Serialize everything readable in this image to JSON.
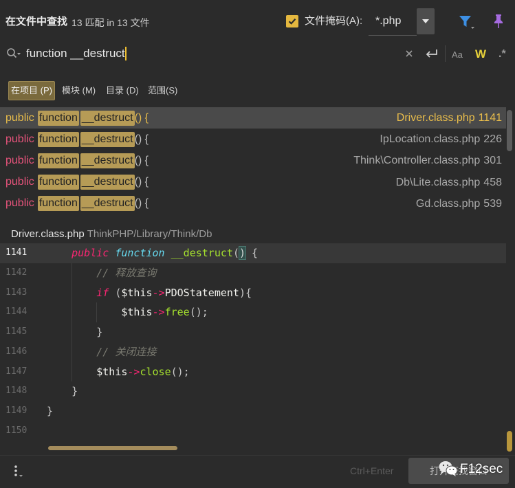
{
  "header": {
    "title": "在文件中查找",
    "summary": "13 匹配 in 13 文件"
  },
  "file_mask": {
    "enabled": true,
    "label": "文件掩码(A):",
    "value": "*.php"
  },
  "search": {
    "query": "function __destruct"
  },
  "search_options": {
    "match_case": "Aa",
    "whole_words": "W",
    "regex": ".*"
  },
  "scope_tabs": [
    {
      "label": "在项目 (P)",
      "selected": true
    },
    {
      "label": "模块 (M)",
      "selected": false
    },
    {
      "label": "目录 (D)",
      "selected": false
    },
    {
      "label": "范围(S)",
      "selected": false
    }
  ],
  "results": [
    {
      "before": "public",
      "match": [
        "function",
        "__destruct"
      ],
      "after": "() {",
      "file": "Driver.class.php",
      "line": "1141",
      "selected": true
    },
    {
      "before": "public",
      "match": [
        "function",
        "__destruct"
      ],
      "after": "() {",
      "file": "IpLocation.class.php",
      "line": "226",
      "selected": false
    },
    {
      "before": "public",
      "match": [
        "function",
        "__destruct"
      ],
      "after": "() {",
      "file": "Think\\Controller.class.php",
      "line": "301",
      "selected": false
    },
    {
      "before": "public",
      "match": [
        "function",
        "__destruct"
      ],
      "after": "() {",
      "file": "Db\\Lite.class.php",
      "line": "458",
      "selected": false
    },
    {
      "before": "public",
      "match": [
        "function",
        "__destruct"
      ],
      "after": "() {",
      "file": "Gd.class.php",
      "line": "539",
      "selected": false
    }
  ],
  "preview": {
    "file": "Driver.class.php",
    "path": "ThinkPHP/Library/Think/Db",
    "lines": [
      {
        "num": "1141",
        "current": true,
        "tokens": [
          [
            "    ",
            "w"
          ],
          [
            "public",
            "k"
          ],
          [
            " ",
            "w"
          ],
          [
            "function",
            "s"
          ],
          [
            " ",
            "w"
          ],
          [
            "__destruct",
            "f"
          ],
          [
            "(",
            "p"
          ],
          [
            ")",
            "m"
          ],
          [
            " {",
            "p"
          ]
        ]
      },
      {
        "num": "1142",
        "tokens": [
          [
            "        ",
            "w"
          ],
          [
            "// 释放查询",
            "c"
          ]
        ]
      },
      {
        "num": "1143",
        "tokens": [
          [
            "        ",
            "w"
          ],
          [
            "if",
            "k"
          ],
          [
            " (",
            "p"
          ],
          [
            "$this",
            "v"
          ],
          [
            "->",
            "o"
          ],
          [
            "PDOStatement",
            "v"
          ],
          [
            "){",
            "p"
          ]
        ]
      },
      {
        "num": "1144",
        "tokens": [
          [
            "            ",
            "w"
          ],
          [
            "$this",
            "v"
          ],
          [
            "->",
            "o"
          ],
          [
            "free",
            "f"
          ],
          [
            "();",
            "p"
          ]
        ]
      },
      {
        "num": "1145",
        "tokens": [
          [
            "        ",
            "w"
          ],
          [
            "}",
            "p"
          ]
        ]
      },
      {
        "num": "1146",
        "tokens": [
          [
            "        ",
            "w"
          ],
          [
            "// 关闭连接",
            "c"
          ]
        ]
      },
      {
        "num": "1147",
        "tokens": [
          [
            "        ",
            "w"
          ],
          [
            "$this",
            "v"
          ],
          [
            "->",
            "o"
          ],
          [
            "close",
            "f"
          ],
          [
            "();",
            "p"
          ]
        ]
      },
      {
        "num": "1148",
        "tokens": [
          [
            "    ",
            "w"
          ],
          [
            "}",
            "p"
          ]
        ]
      },
      {
        "num": "1149",
        "tokens": [
          [
            "}",
            "p"
          ]
        ]
      },
      {
        "num": "1150",
        "tokens": []
      }
    ]
  },
  "footer": {
    "shortcut": "Ctrl+Enter",
    "open_button": "打开查找窗口"
  },
  "watermark": {
    "text": "F12sec"
  },
  "icons": [
    "checkbox-checked-icon",
    "chevron-down-icon",
    "filter-icon",
    "pin-icon",
    "search-history-icon",
    "clear-icon",
    "newline-icon",
    "more-options-icon",
    "wechat-logo-icon"
  ],
  "colors": {
    "background": "#2b2b2b",
    "accent": "#e9bd4b",
    "match_highlight": "#b69b56",
    "selected_row": "#4a4a4a",
    "keyword": "#f92672",
    "storage": "#66d9ef",
    "function_name": "#a6e22e",
    "comment": "#7a7a70",
    "filter_icon": "#3d8fe3",
    "pin_icon": "#a66be0",
    "words_toggle": "#e6d03a"
  }
}
